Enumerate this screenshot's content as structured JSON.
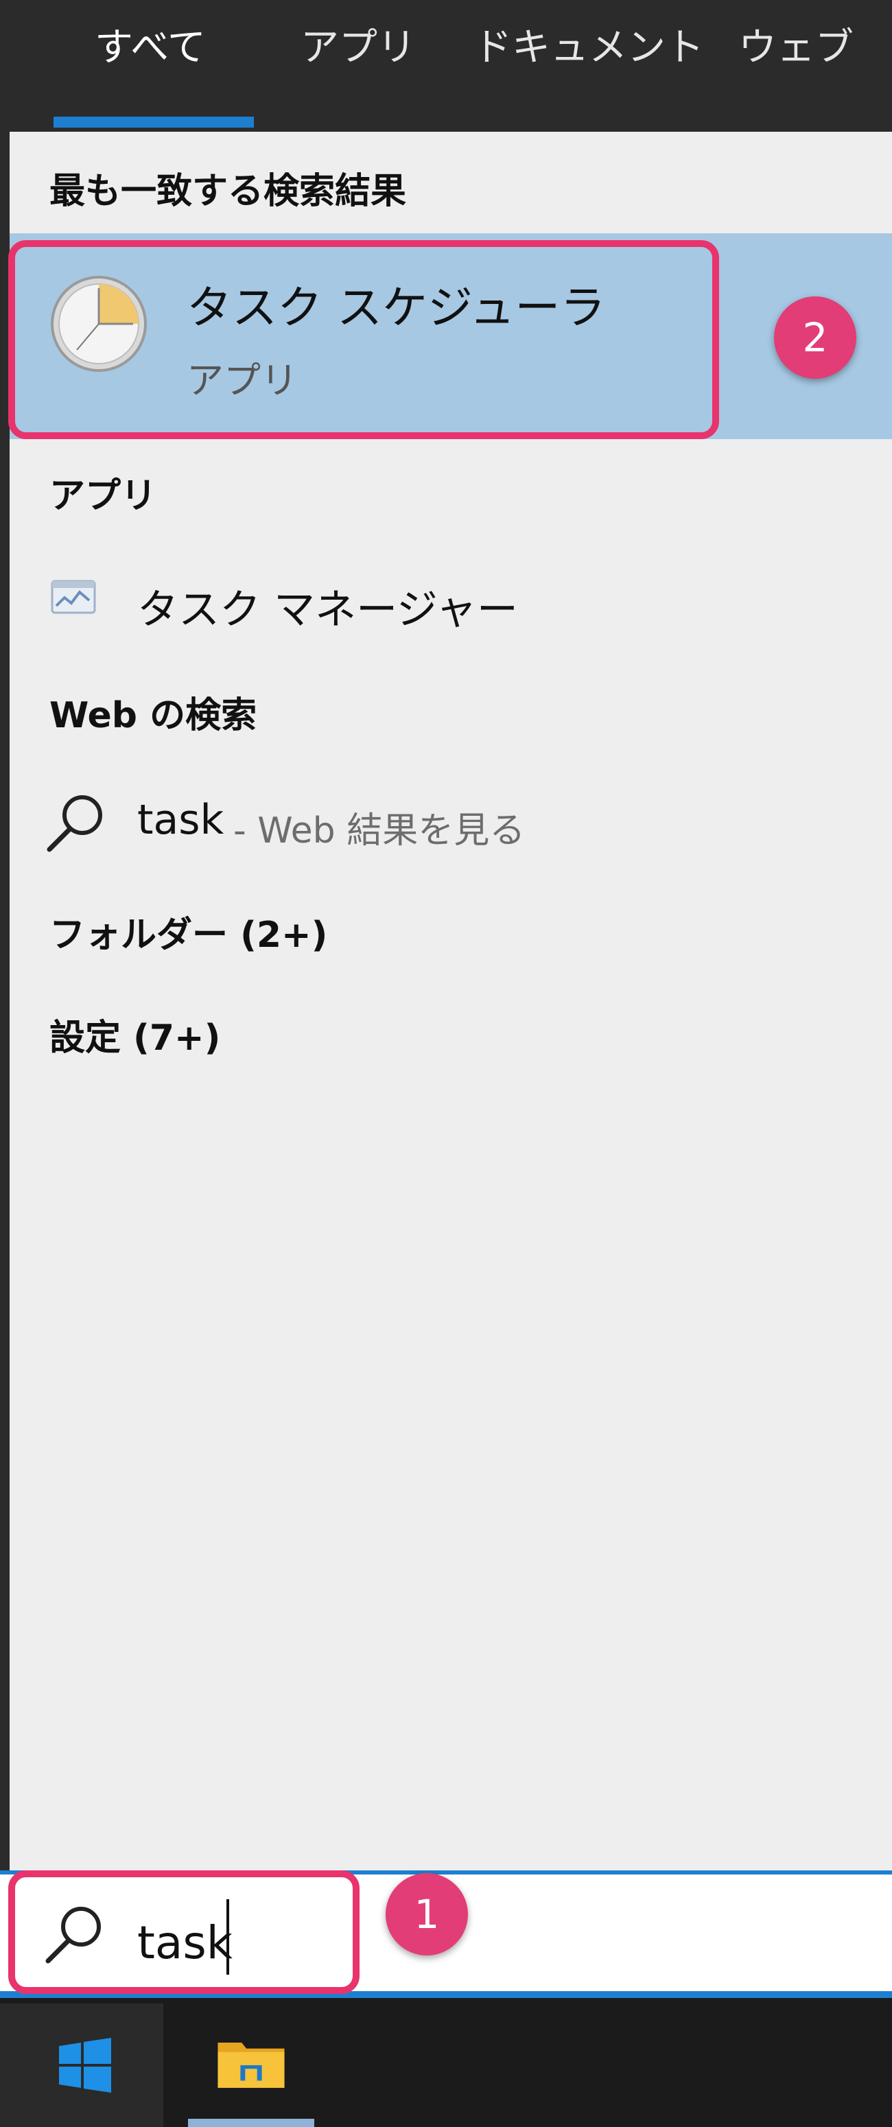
{
  "tabs": [
    {
      "label": "すべて",
      "active": true
    },
    {
      "label": "アプリ"
    },
    {
      "label": "ドキュメント"
    },
    {
      "label": "ウェブ"
    }
  ],
  "sections": {
    "best_match": "最も一致する検索結果",
    "apps": "アプリ",
    "web": "Web の検索",
    "folders": "フォルダー (2+)",
    "settings": "設定 (7+)"
  },
  "best_match": {
    "title": "タスク スケジューラ",
    "subtitle": "アプリ",
    "icon": "clock-icon"
  },
  "apps": [
    {
      "label": "タスク マネージャー",
      "icon": "task-manager-icon"
    }
  ],
  "web_result": {
    "query": "task",
    "suffix": "- Web 結果を見る",
    "icon": "search-icon"
  },
  "search": {
    "value": "task"
  },
  "badges": {
    "step1": "1",
    "step2": "2"
  },
  "colors": {
    "accent": "#1e7fd0",
    "highlight": "#a6c8e3",
    "annotation": "#e8336d"
  },
  "taskbar": {
    "items": [
      "windows-start-icon",
      "file-explorer-icon"
    ]
  }
}
